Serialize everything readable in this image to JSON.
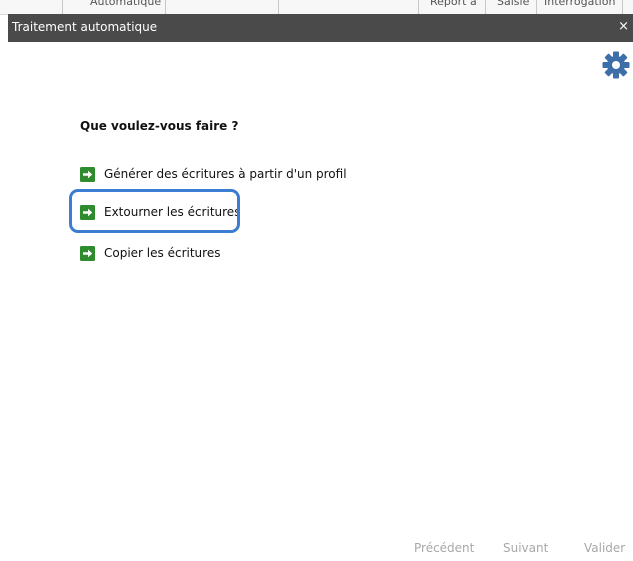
{
  "background": {
    "tabs": [
      "Automatique",
      "Report à",
      "Saisie",
      "Interrogation"
    ]
  },
  "window": {
    "title": "Traitement automatique",
    "close_glyph": "×",
    "settings_icon": "gear-icon"
  },
  "main": {
    "question": "Que voulez-vous faire ?",
    "options": [
      {
        "label": "Générer des écritures à partir d'un profil",
        "icon": "arrow-right-icon"
      },
      {
        "label": "Extourner les écritures",
        "icon": "arrow-right-icon",
        "highlighted": true
      },
      {
        "label": "Copier les écritures",
        "icon": "arrow-right-icon"
      }
    ]
  },
  "footer": {
    "previous": "Précédent",
    "next": "Suivant",
    "validate": "Valider"
  },
  "colors": {
    "titlebar": "#4a4a4a",
    "accent": "#3b7dd0",
    "arrow_icon": "#2e8b2e",
    "gear": "#3d6ea8",
    "disabled_text": "#a8a8a8"
  }
}
